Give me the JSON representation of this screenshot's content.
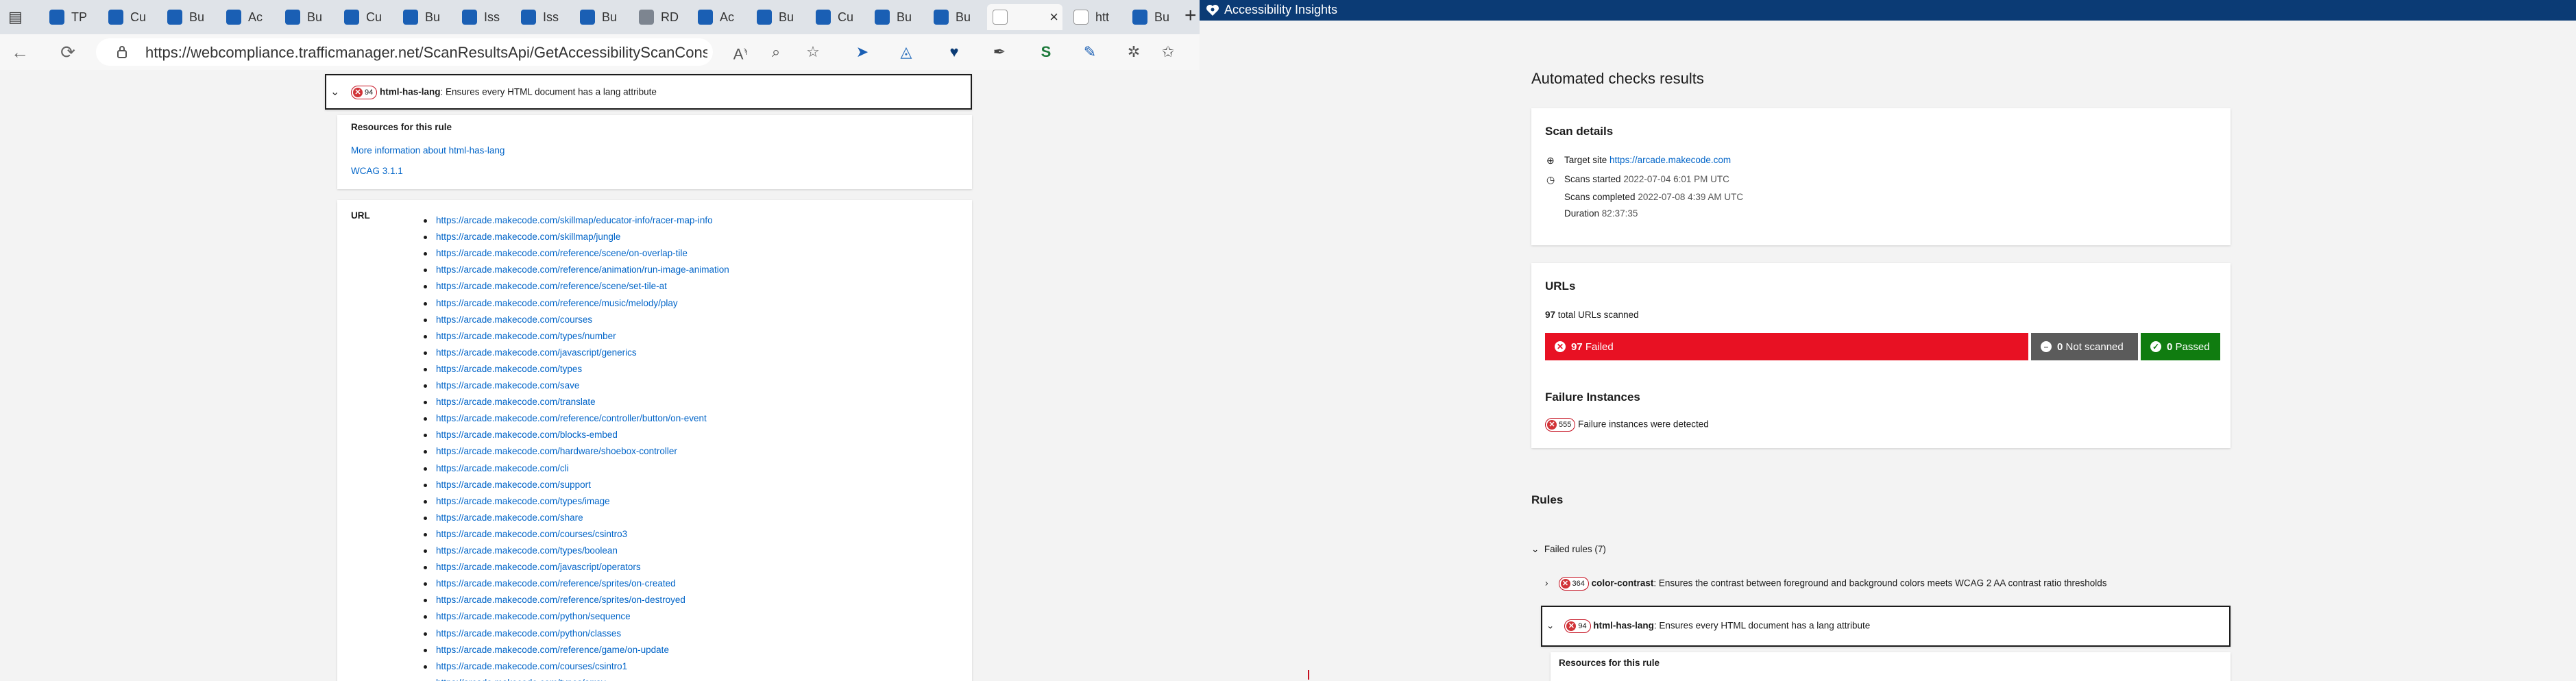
{
  "browser": {
    "tabs": [
      {
        "label": "",
        "type": "sidebar"
      },
      {
        "label": "TP",
        "fav": "blue"
      },
      {
        "label": "Cu",
        "fav": "blue"
      },
      {
        "label": "Bu",
        "fav": "blue"
      },
      {
        "label": "Ac",
        "fav": "blue"
      },
      {
        "label": "Bu",
        "fav": "blue"
      },
      {
        "label": "Cu",
        "fav": "blue"
      },
      {
        "label": "Bu",
        "fav": "blue"
      },
      {
        "label": "Iss",
        "fav": "blue"
      },
      {
        "label": "Iss",
        "fav": "blue"
      },
      {
        "label": "Bu",
        "fav": "blue"
      },
      {
        "label": "RD",
        "fav": "gray"
      },
      {
        "label": "Ac",
        "fav": "blue"
      },
      {
        "label": "Bu",
        "fav": "blue"
      },
      {
        "label": "Cu",
        "fav": "blue"
      },
      {
        "label": "Bu",
        "fav": "blue"
      },
      {
        "label": "Bu",
        "fav": "blue"
      },
      {
        "label": "",
        "fav": "white",
        "active": true
      },
      {
        "label": "htt",
        "fav": "white"
      },
      {
        "label": "Bu",
        "fav": "blue"
      }
    ],
    "close_tab": "×",
    "new_tab": "+",
    "minimize": "—",
    "url": "https://webcompliance.trafficmanager.net/ScanResultsApi/GetAccessibilityScanConsolid...",
    "nav": {
      "back": "←",
      "refresh": "⟳"
    }
  },
  "left_page": {
    "rule_header": {
      "count": "94",
      "rule_id": "html-has-lang",
      "description": ": Ensures every HTML document has a lang attribute"
    },
    "resources": {
      "title": "Resources for this rule",
      "links": [
        "More information about html-has-lang",
        "WCAG 3.1.1"
      ]
    },
    "url_label": "URL",
    "urls": [
      "https://arcade.makecode.com/skillmap/educator-info/racer-map-info",
      "https://arcade.makecode.com/skillmap/jungle",
      "https://arcade.makecode.com/reference/scene/on-overlap-tile",
      "https://arcade.makecode.com/reference/animation/run-image-animation",
      "https://arcade.makecode.com/reference/scene/set-tile-at",
      "https://arcade.makecode.com/reference/music/melody/play",
      "https://arcade.makecode.com/courses",
      "https://arcade.makecode.com/types/number",
      "https://arcade.makecode.com/javascript/generics",
      "https://arcade.makecode.com/types",
      "https://arcade.makecode.com/save",
      "https://arcade.makecode.com/translate",
      "https://arcade.makecode.com/reference/controller/button/on-event",
      "https://arcade.makecode.com/blocks-embed",
      "https://arcade.makecode.com/hardware/shoebox-controller",
      "https://arcade.makecode.com/cli",
      "https://arcade.makecode.com/support",
      "https://arcade.makecode.com/types/image",
      "https://arcade.makecode.com/share",
      "https://arcade.makecode.com/courses/csintro3",
      "https://arcade.makecode.com/types/boolean",
      "https://arcade.makecode.com/javascript/operators",
      "https://arcade.makecode.com/reference/sprites/on-created",
      "https://arcade.makecode.com/reference/sprites/on-destroyed",
      "https://arcade.makecode.com/python/sequence",
      "https://arcade.makecode.com/python/classes",
      "https://arcade.makecode.com/reference/game/on-update",
      "https://arcade.makecode.com/courses/csintro1",
      "https://arcade.makecode.com/types/array"
    ]
  },
  "app": {
    "title": "Accessibility Insights",
    "heading": "Automated checks results",
    "scan_details": {
      "title": "Scan details",
      "target_label": "Target site",
      "target_url": "https://arcade.makecode.com",
      "started_label": "Scans started",
      "started_value": "2022-07-04 6:01 PM UTC",
      "completed_label": "Scans completed",
      "completed_value": "2022-07-08 4:39 AM UTC",
      "duration_label": "Duration",
      "duration_value": "82:37:35"
    },
    "urls_card": {
      "title": "URLs",
      "total_count": "97",
      "total_text": "total URLs scanned",
      "failed_count": "97",
      "failed_label": "Failed",
      "not_scanned_count": "0",
      "not_scanned_label": "Not scanned",
      "passed_count": "0",
      "passed_label": "Passed",
      "failed_fraction": 0.719
    },
    "failure_instances": {
      "title": "Failure Instances",
      "count": "555",
      "text": "Failure instances were detected"
    },
    "rules": {
      "title": "Rules",
      "failed_group": "Failed rules (7)",
      "items": [
        {
          "count": "364",
          "rule_id": "color-contrast",
          "description": ": Ensures the contrast between foreground and background colors meets WCAG 2 AA contrast ratio thresholds"
        },
        {
          "count": "94",
          "rule_id": "html-has-lang",
          "description": ": Ensures every HTML document has a lang attribute"
        }
      ],
      "resources_title": "Resources for this rule"
    }
  },
  "colors": {
    "failed": "#e81123",
    "not_scanned": "#5b5b5b",
    "passed": "#107c10",
    "title_bar": "#0b3b75",
    "link": "#0064c8"
  }
}
